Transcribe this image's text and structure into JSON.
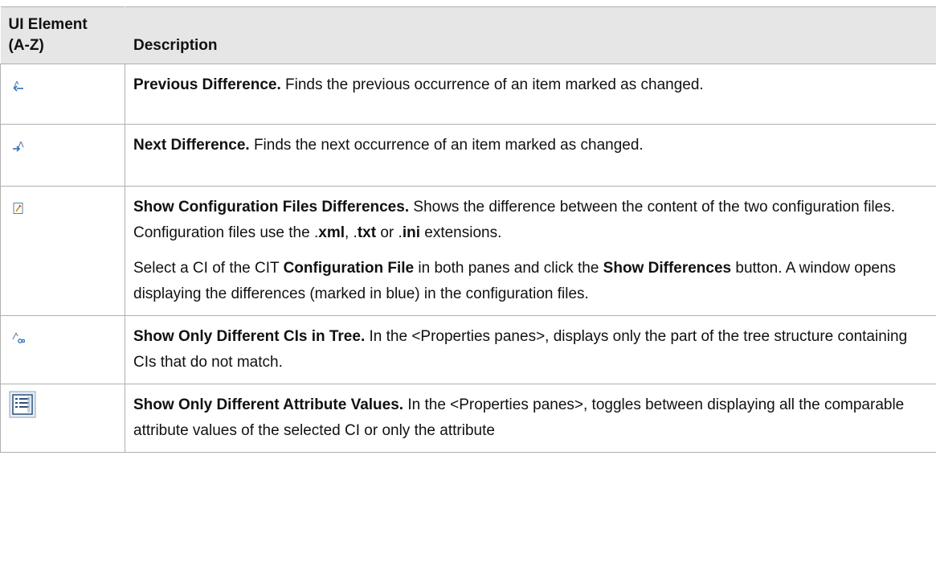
{
  "headers": {
    "element": "UI Element\n(A-Z)",
    "element_line1": "UI Element",
    "element_line2": "(A-Z)",
    "description": "Description"
  },
  "rows": [
    {
      "icon": "previous-difference-icon",
      "title": "Previous Difference.",
      "text": "Finds the previous occurrence of an item marked as changed."
    },
    {
      "icon": "next-difference-icon",
      "title": "Next Difference.",
      "text": "Finds the next occurrence of an item marked as changed."
    },
    {
      "icon": "show-config-diff-icon",
      "title": "Show Configuration Files Differences.",
      "p1_text": "Shows the difference between the content of the two configuration files. Configuration files use the .",
      "ext_xml": "xml",
      "sep1": ", .",
      "ext_txt": "txt",
      "sep2": " or .",
      "ext_ini": "ini",
      "p1_end": " extensions.",
      "p2_a": "Select a CI of the CIT ",
      "p2_cit": "Configuration File",
      "p2_b": " in both panes and click the ",
      "p2_btn": "Show Differences",
      "p2_c": " button. A window opens displaying the differences (marked in blue) in the configuration files."
    },
    {
      "icon": "show-only-different-cis-icon",
      "title": "Show Only Different CIs in Tree.",
      "text": "In the <Properties panes>, displays only the part of the tree structure containing CIs that do not match."
    },
    {
      "icon": "show-only-different-attributes-icon",
      "title": "Show Only Different Attribute Values.",
      "text": "In the <Properties panes>, toggles between displaying all the comparable attribute values of the selected CI or only the attribute"
    }
  ]
}
